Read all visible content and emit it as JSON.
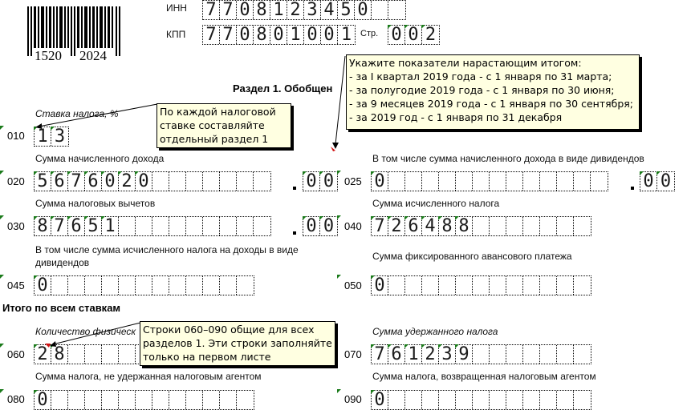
{
  "barcode": {
    "number_left": "1520",
    "number_right": "2024"
  },
  "header": {
    "inn_label": "ИНН",
    "inn_digits": [
      "7",
      "7",
      "0",
      "8",
      "1",
      "2",
      "3",
      "4",
      "5",
      "0",
      "",
      ""
    ],
    "kpp_label": "КПП",
    "kpp_digits": [
      "7",
      "7",
      "0",
      "8",
      "0",
      "1",
      "0",
      "0",
      "1"
    ],
    "page_label": "Стр.",
    "page_digits": [
      "0",
      "0",
      "2"
    ]
  },
  "section_title": "Раздел 1. Обобщен",
  "totals_title": "Итого по всем ставкам",
  "fields": {
    "f010": {
      "code": "010",
      "label": "Ставка налога, %",
      "digits": [
        "1",
        "3"
      ]
    },
    "f020": {
      "code": "020",
      "label": "Сумма начисленного дохода",
      "digits": [
        "5",
        "6",
        "7",
        "6",
        "0",
        "2",
        "0",
        "",
        "",
        "",
        "",
        "",
        "",
        ""
      ],
      "kopecks": [
        "0",
        "0"
      ]
    },
    "f025": {
      "code": "025",
      "label": "В том числе сумма начисленного дохода в виде дивидендов",
      "digits": [
        "0",
        "",
        "",
        "",
        "",
        "",
        "",
        "",
        "",
        "",
        "",
        "",
        "",
        ""
      ],
      "kopecks": [
        "0",
        "0"
      ]
    },
    "f030": {
      "code": "030",
      "label": "Сумма налоговых вычетов",
      "digits": [
        "8",
        "7",
        "6",
        "5",
        "1",
        "",
        "",
        "",
        "",
        "",
        "",
        "",
        "",
        ""
      ],
      "kopecks": [
        "0",
        "0"
      ]
    },
    "f040": {
      "code": "040",
      "label": "Сумма исчисленного налога",
      "digits": [
        "7",
        "2",
        "6",
        "4",
        "8",
        "8",
        "",
        "",
        "",
        "",
        "",
        "",
        ""
      ]
    },
    "f045": {
      "code": "045",
      "label": "В том числе сумма исчисленного налога на доходы в виде дивидендов",
      "digits": [
        "0",
        "",
        "",
        "",
        "",
        "",
        "",
        "",
        "",
        "",
        "",
        "",
        ""
      ]
    },
    "f050": {
      "code": "050",
      "label": "Сумма фиксированного авансового платежа",
      "digits": [
        "0",
        "",
        "",
        "",
        "",
        "",
        "",
        "",
        "",
        "",
        "",
        "",
        ""
      ]
    },
    "f060": {
      "code": "060",
      "label": "Количество физическ",
      "digits": [
        "2",
        "8",
        "",
        "",
        "",
        "",
        "",
        "",
        "",
        "",
        "",
        "",
        ""
      ]
    },
    "f070": {
      "code": "070",
      "label": "Сумма удержанного налога",
      "digits": [
        "7",
        "6",
        "1",
        "2",
        "3",
        "9",
        "",
        "",
        "",
        "",
        "",
        "",
        ""
      ]
    },
    "f080": {
      "code": "080",
      "label": "Сумма налога, не удержанная налоговым агентом",
      "digits": [
        "0",
        "",
        "",
        "",
        "",
        "",
        "",
        "",
        "",
        "",
        "",
        "",
        ""
      ]
    },
    "f090": {
      "code": "090",
      "label": "Сумма налога, возвращенная налоговым агентом",
      "digits": [
        "0",
        "",
        "",
        "",
        "",
        "",
        "",
        "",
        "",
        "",
        "",
        "",
        ""
      ]
    }
  },
  "notes": {
    "cumulative": [
      "Укажите показатели нарастающим итогом:",
      "- за I квартал 2019 года - с 1 января по 31 марта;",
      "- за полугодие 2019 года - с 1 января по 30 июня;",
      "- за 9 месяцев 2019 года - с 1 января по 30 сентября;",
      "- за 2019 год - с 1 января по 31 декабря"
    ],
    "per_rate": [
      "По каждой налоговой",
      "ставке составляйте",
      "отдельный раздел 1"
    ],
    "common_rows": [
      "Строки 060–090 общие для всех",
      "разделов 1. Эти строки заполняйте",
      "только на первом листе"
    ]
  },
  "colors": {
    "note_bg": "#ffffe1",
    "mark_green": "#1a7a1a",
    "mark_red": "#d01010"
  }
}
